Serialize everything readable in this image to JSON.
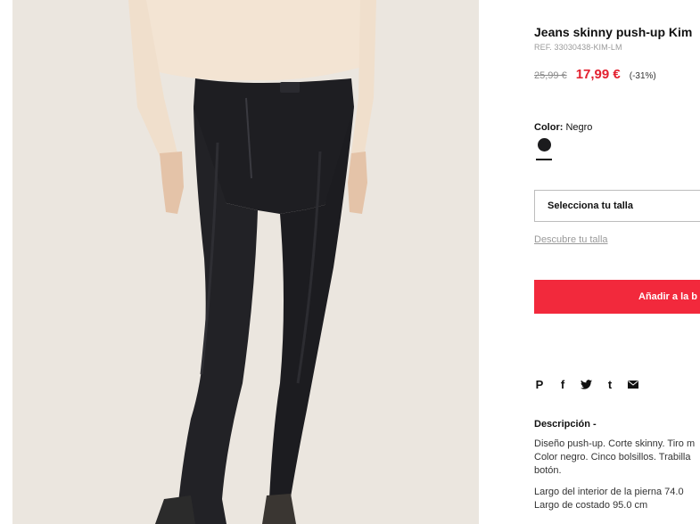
{
  "product": {
    "title": "Jeans skinny push-up Kim",
    "ref": "REF. 33030438-KIM-LM",
    "old_price": "25,99 €",
    "new_price": "17,99 €",
    "discount": "(-31%)"
  },
  "color": {
    "label": "Color:",
    "value": "Negro",
    "swatch_hex": "#1b1b1d"
  },
  "size": {
    "select_label": "Selecciona tu talla",
    "discover_link": "Descubre tu talla"
  },
  "cart": {
    "add_label": "Añadir a la b"
  },
  "share": {
    "icons": [
      "pinterest-icon",
      "facebook-icon",
      "twitter-icon",
      "tumblr-icon",
      "email-icon"
    ],
    "pinterest": "P",
    "facebook": "f",
    "tumblr": "t"
  },
  "description": {
    "heading": "Descripción -",
    "line1": "Diseño push-up. Corte skinny. Tiro m",
    "line2": "Color negro. Cinco bolsillos. Trabilla",
    "line3": "botón.",
    "line4": "Largo del interior de la pierna 74.0",
    "line5": "Largo de costado 95.0 cm"
  },
  "colors": {
    "accent": "#f2293c",
    "sale_price": "#e3202f"
  }
}
